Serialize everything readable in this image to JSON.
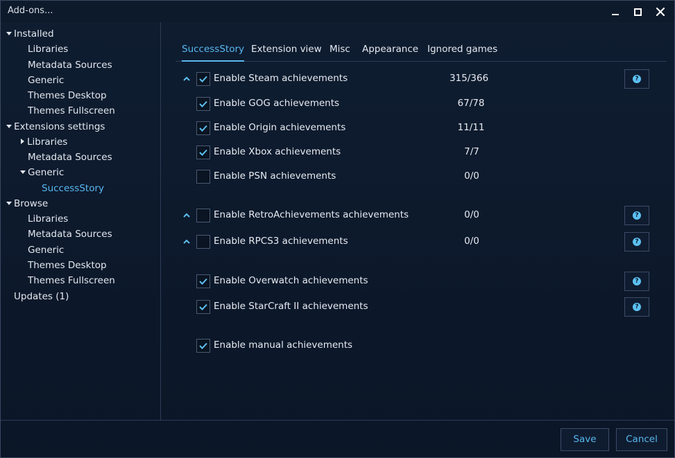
{
  "window": {
    "title": "Add-ons...",
    "minimize_icon": "minimize-icon",
    "maximize_icon": "maximize-icon",
    "close_icon": "close-icon"
  },
  "sidebar": {
    "installed": {
      "label": "Installed",
      "items": [
        "Libraries",
        "Metadata Sources",
        "Generic",
        "Themes Desktop",
        "Themes Fullscreen"
      ]
    },
    "extensions": {
      "label": "Extensions settings",
      "libraries": "Libraries",
      "metadata": "Metadata Sources",
      "generic": "Generic",
      "successstory": "SuccessStory"
    },
    "browse": {
      "label": "Browse",
      "items": [
        "Libraries",
        "Metadata Sources",
        "Generic",
        "Themes Desktop",
        "Themes Fullscreen"
      ]
    },
    "updates": "Updates (1)"
  },
  "tabs": [
    "SuccessStory",
    "Extension view",
    "Misc",
    "Appearance",
    "Ignored games"
  ],
  "settings": [
    {
      "label": "Enable Steam achievements",
      "checked": true,
      "count": "315/366",
      "caret": true,
      "help": true
    },
    {
      "label": "Enable GOG achievements",
      "checked": true,
      "count": "67/78",
      "caret": false,
      "help": false
    },
    {
      "label": "Enable Origin achievements",
      "checked": true,
      "count": "11/11",
      "caret": false,
      "help": false
    },
    {
      "label": "Enable Xbox achievements",
      "checked": true,
      "count": "7/7",
      "caret": false,
      "help": false
    },
    {
      "label": "Enable PSN achievements",
      "checked": false,
      "count": "0/0",
      "caret": false,
      "help": false
    },
    {
      "label": "Enable RetroAchievements achievements",
      "checked": false,
      "count": "0/0",
      "caret": true,
      "help": true
    },
    {
      "label": "Enable RPCS3 achievements",
      "checked": false,
      "count": "0/0",
      "caret": true,
      "help": true
    },
    {
      "label": "Enable Overwatch achievements",
      "checked": true,
      "count": "",
      "caret": false,
      "help": true
    },
    {
      "label": "Enable StarCraft II achievements",
      "checked": true,
      "count": "",
      "caret": false,
      "help": true
    },
    {
      "label": "Enable manual achievements",
      "checked": true,
      "count": "",
      "caret": false,
      "help": false
    }
  ],
  "footer": {
    "save_label": "Save",
    "cancel_label": "Cancel"
  },
  "colors": {
    "accent": "#58b8f0",
    "background": "#0d1a2c",
    "border": "#2d3c55"
  }
}
